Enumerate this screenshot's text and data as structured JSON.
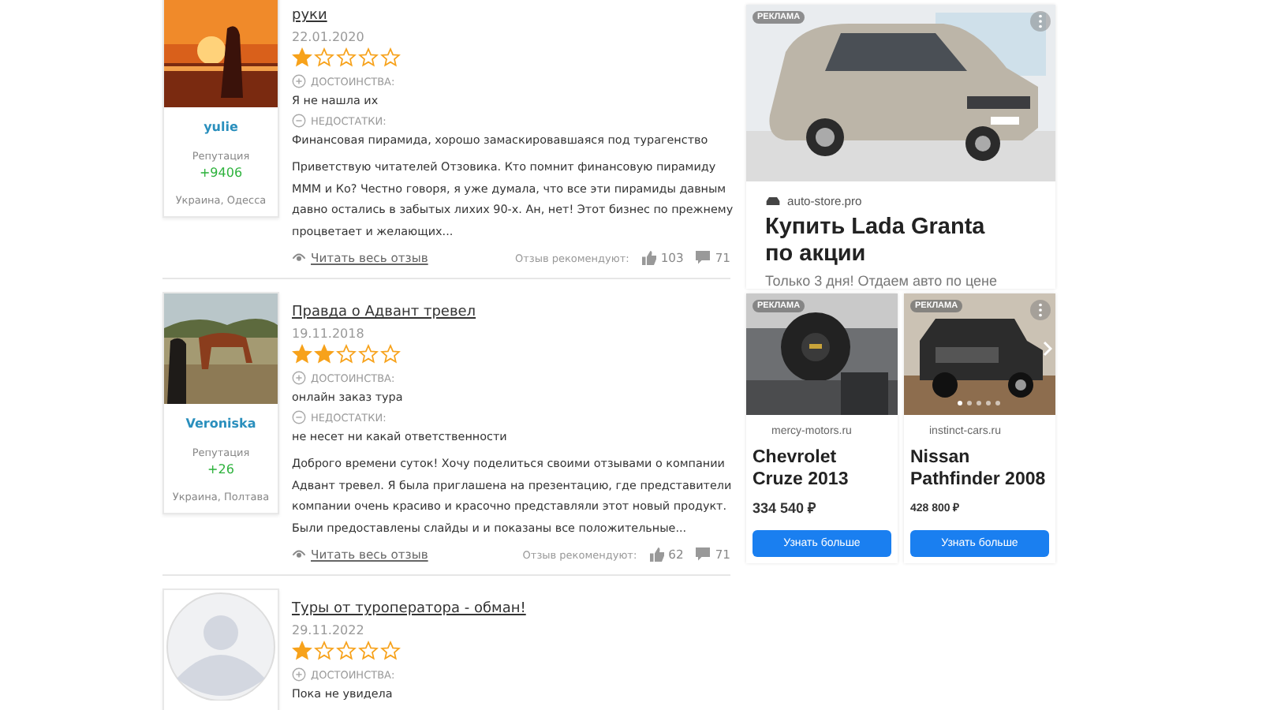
{
  "reviews": [
    {
      "author": {
        "name": "yulie",
        "reputation_label": "Репутация",
        "reputation": "+9406",
        "location": "Украина, Одесса"
      },
      "title": "руки",
      "date": "22.01.2020",
      "stars": 1,
      "pros_label": "ДОСТОИНСТВА:",
      "pros": "Я не нашла их",
      "cons_label": "НЕДОСТАТКИ:",
      "cons": "Финансовая пирамида, хорошо замаскировавшаяся под турагенство",
      "text": "Приветствую читателей Отзовика. Кто помнит финансовую пирамиду МММ и Ко? Честно говоря, я уже думала, что все эти пирамиды давным давно остались в забытых лихих 90-х. Ан, нет! Этот бизнес по прежнему процветает и желающих...",
      "read_more": "Читать весь отзыв",
      "recommend_label": "Отзыв рекомендуют:",
      "likes": "103",
      "comments": "71"
    },
    {
      "author": {
        "name": "Veroniska",
        "reputation_label": "Репутация",
        "reputation": "+26",
        "location": "Украина, Полтава"
      },
      "title": "Правда о Адвант тревел",
      "date": "19.11.2018",
      "stars": 2,
      "pros_label": "ДОСТОИНСТВА:",
      "pros": "онлайн заказ тура",
      "cons_label": "НЕДОСТАТКИ:",
      "cons": "не несет ни какай ответственности",
      "text": "Доброго времени суток! Хочу поделиться своими отзывами о компании Адвант тревел. Я была приглашена на презентацию, где представители компании очень красиво и красочно представляли этот новый продукт. Были предоставлены слайды и и показаны все положительные...",
      "read_more": "Читать весь отзыв",
      "recommend_label": "Отзыв рекомендуют:",
      "likes": "62",
      "comments": "71"
    },
    {
      "title": "Туры от туроператора - обман!",
      "date": "29.11.2022",
      "stars": 1,
      "pros_label": "ДОСТОИНСТВА:",
      "pros": "Пока не увидела"
    }
  ],
  "ads": {
    "main": {
      "badge": "РЕКЛАМА",
      "domain": "auto-store.pro",
      "title": "Купить Lada Granta по акции",
      "subtitle": "Только 3 дня! Отдаем авто по цене"
    },
    "small": [
      {
        "badge": "РЕКЛАМА",
        "domain": "mercy-motors.ru",
        "title": "Chevrolet Cruze 2013",
        "price": "334 540 ₽",
        "button": "Узнать больше",
        "carousel": false
      },
      {
        "badge": "РЕКЛАМА",
        "domain": "instinct-cars.ru",
        "title": "Nissan Pathfinder 2008",
        "price": "428 800 ₽",
        "button": "Узнать больше",
        "carousel": true
      }
    ]
  }
}
